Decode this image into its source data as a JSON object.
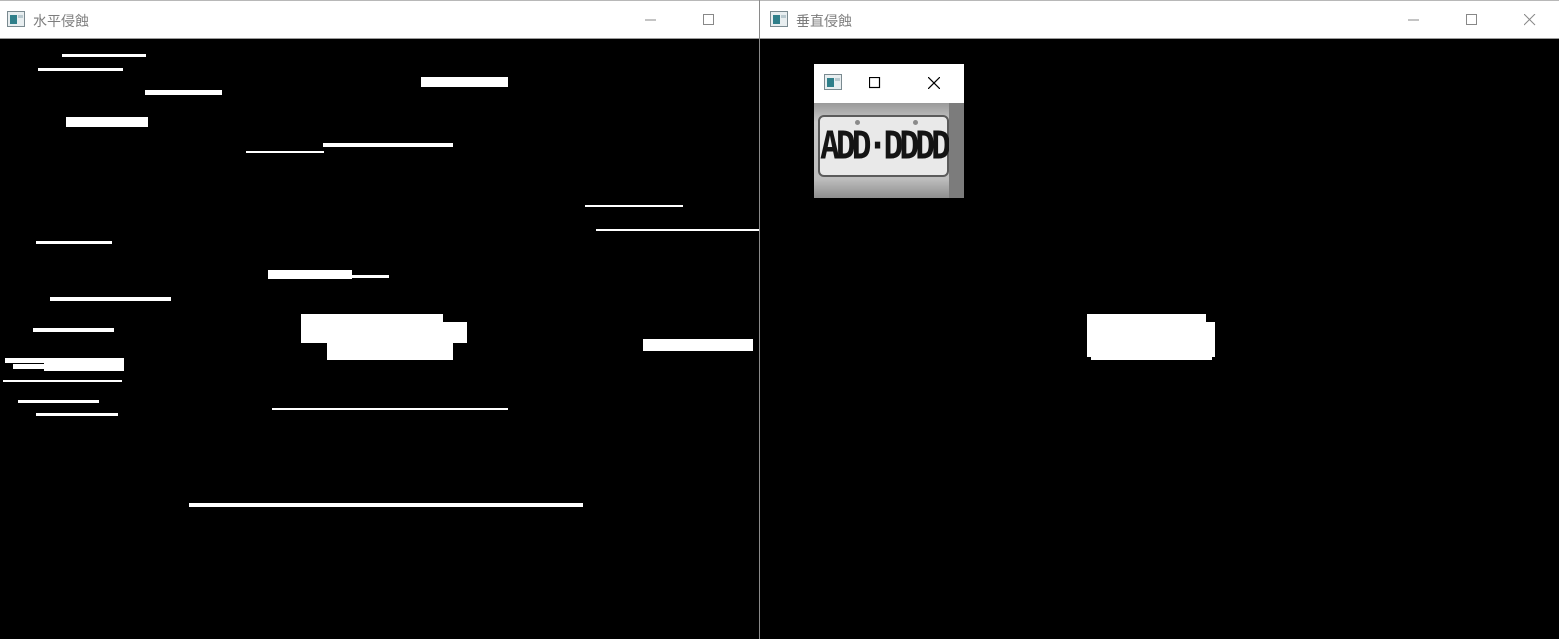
{
  "windows": {
    "left": {
      "title": "水平侵蝕",
      "icon": "app-window-icon"
    },
    "right": {
      "title": "垂直侵蝕",
      "icon": "app-window-icon"
    },
    "preview": {
      "title": "",
      "icon": "app-window-icon",
      "plate_text": "ADD·DDDD"
    }
  },
  "colors": {
    "canvas": "#000000",
    "foreground": "#ffffff",
    "titlebar": "#ffffff",
    "title_text": "#7d7d7d"
  }
}
